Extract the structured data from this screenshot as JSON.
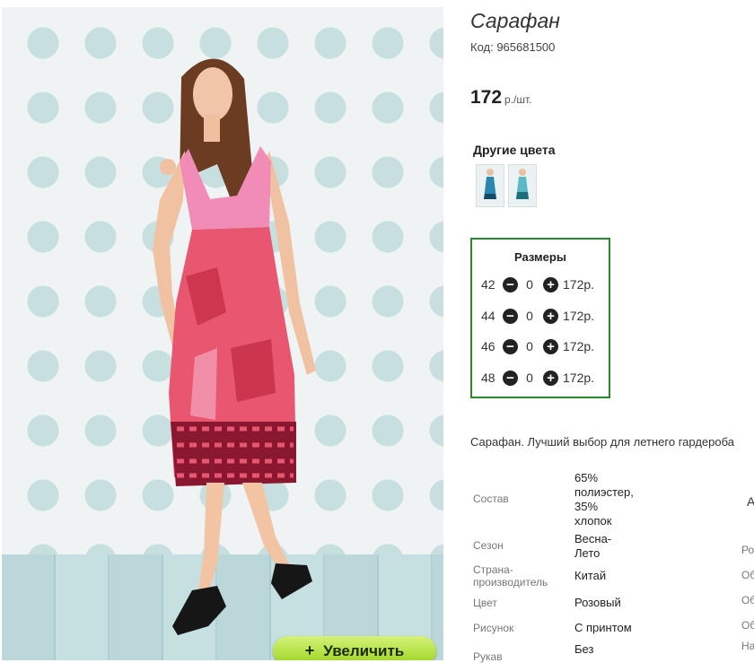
{
  "product": {
    "title": "Сарафан",
    "code": "Код: 965681500",
    "price_value": "172",
    "price_unit": "р./шт."
  },
  "photo": {
    "zoom_label": "Увеличить",
    "zoom_icon": "+"
  },
  "other_colors": {
    "title": "Другие цвета",
    "thumbs": [
      "blue-dress-thumb-1",
      "blue-dress-thumb-2"
    ]
  },
  "sizes": {
    "title": "Размеры",
    "rows": [
      {
        "size": "42",
        "qty": "0",
        "price": "172р."
      },
      {
        "size": "44",
        "qty": "0",
        "price": "172р."
      },
      {
        "size": "46",
        "qty": "0",
        "price": "172р."
      },
      {
        "size": "48",
        "qty": "0",
        "price": "172р."
      }
    ],
    "minus": "−",
    "plus": "+"
  },
  "description": "Сарафан. Лучший выбор для летнего гардероба",
  "attributes": [
    {
      "label": "Состав",
      "value": [
        "65%",
        "полиэстер,",
        "35%",
        "хлопок"
      ]
    },
    {
      "label": "Сезон",
      "value": [
        "Весна-",
        "Лето"
      ]
    },
    {
      "label": [
        "Страна-",
        "производитель"
      ],
      "value": [
        "Китай"
      ]
    },
    {
      "label": "Цвет",
      "value": [
        "Розовый"
      ]
    },
    {
      "label": "Рисунок",
      "value": [
        "С принтом"
      ]
    },
    {
      "label": "Рукав",
      "value": [
        "Без"
      ]
    }
  ],
  "side_fragments": [
    "А",
    "Ро",
    "Об",
    "Об",
    "Об",
    "На"
  ],
  "colors": {
    "accent_green": "#2a8a2a",
    "zoom_button": "#b5e04a"
  }
}
